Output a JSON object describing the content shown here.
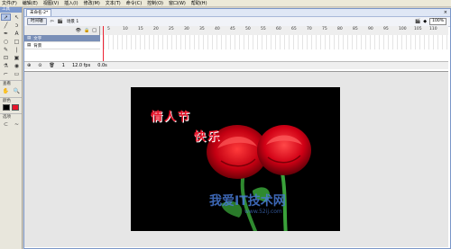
{
  "menu": [
    "文件(F)",
    "编辑(E)",
    "视图(V)",
    "插入(I)",
    "修改(M)",
    "文本(T)",
    "命令(C)",
    "控制(O)",
    "窗口(W)",
    "帮助(H)"
  ],
  "toolbox": {
    "title": "工具",
    "view_label": "查看",
    "color_label": "颜色",
    "options_label": "选项"
  },
  "doc": {
    "tab": "未命名-2*",
    "timeline_btn": "时间轴",
    "scene": "场景 1",
    "zoom": "100%"
  },
  "timeline": {
    "ruler": [
      "5",
      "10",
      "15",
      "20",
      "25",
      "30",
      "35",
      "40",
      "45",
      "50",
      "55",
      "60",
      "65",
      "70",
      "75",
      "80",
      "85",
      "90",
      "95",
      "100",
      "105",
      "110"
    ],
    "layers": [
      {
        "name": "文字"
      },
      {
        "name": "背景"
      }
    ],
    "frame_no": "1",
    "fps": "12.0 fps",
    "time": "0.0s"
  },
  "stage": {
    "line1": "情人节",
    "line2": "快乐"
  },
  "watermark": {
    "text": "我爱IT技术网",
    "url": "www.52ij.com"
  },
  "colors": {
    "accent": "#e8142a",
    "stage_bg": "#000000"
  }
}
